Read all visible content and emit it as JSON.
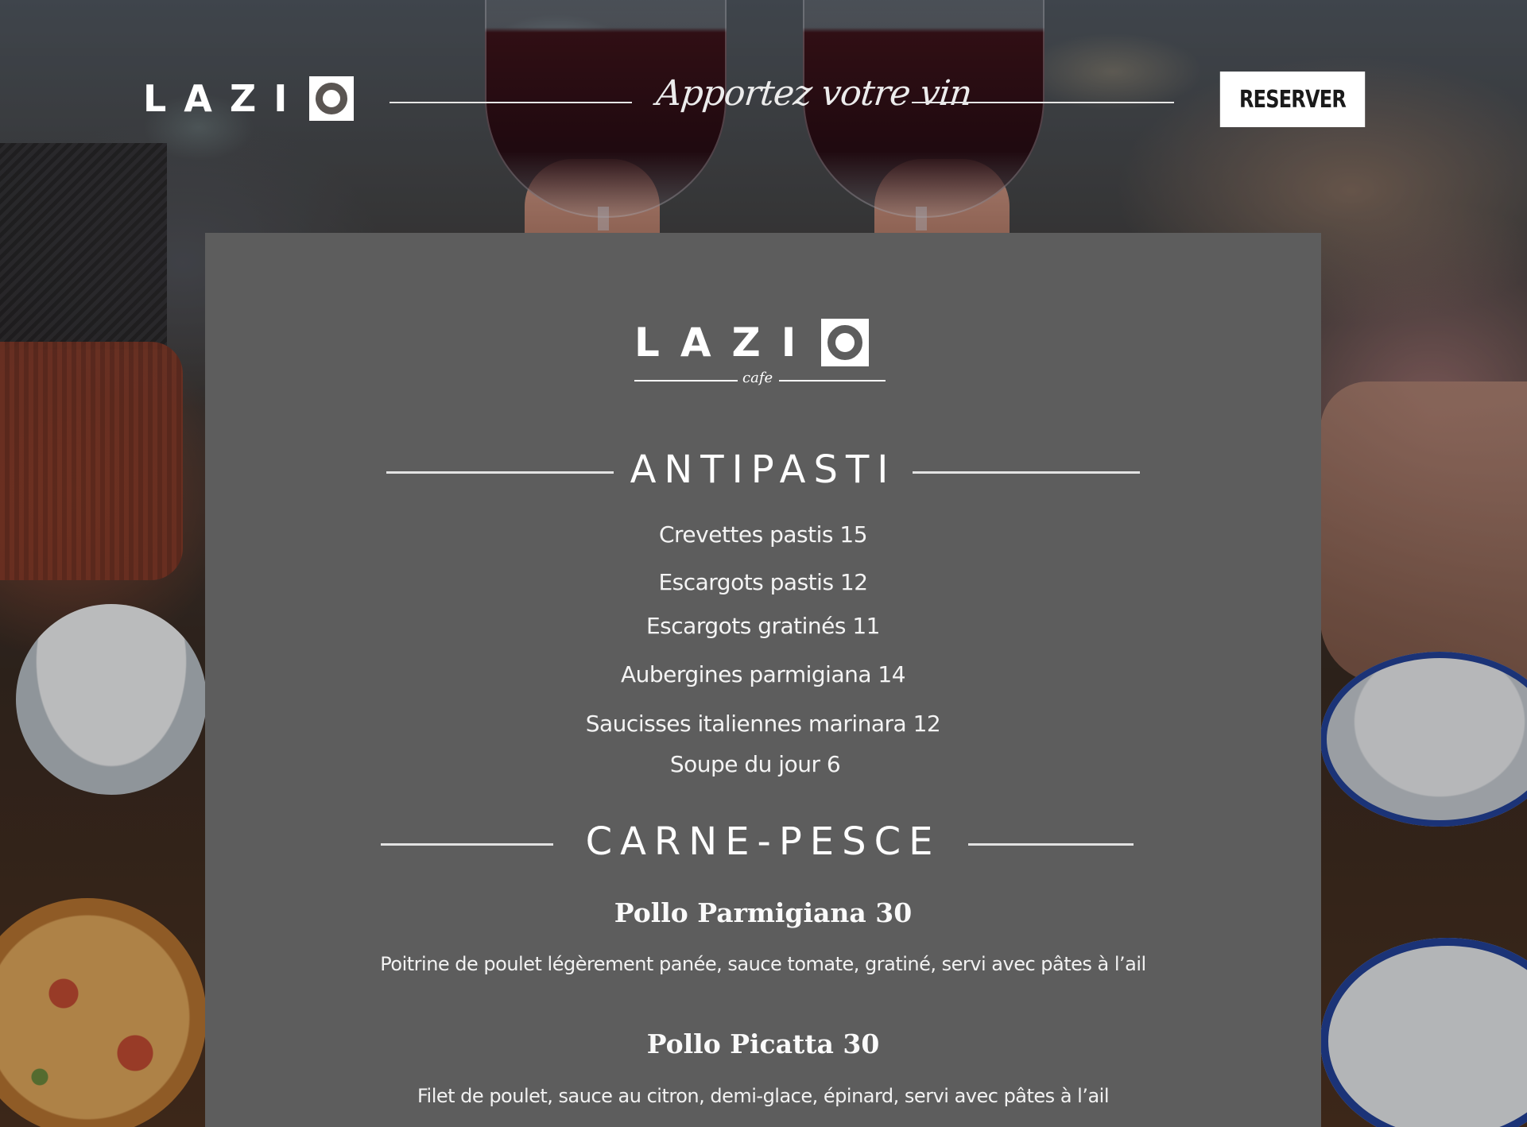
{
  "header": {
    "logo_text": "LAZI",
    "tagline": "Apportez votre vin",
    "reserve_label": "RESERVER"
  },
  "card": {
    "logo_text": "LAZI",
    "logo_subtext": "cafe",
    "sections": [
      {
        "title": "ANTIPASTI",
        "items": [
          "Crevettes pastis 15",
          "Escargots pastis 12",
          "Escargots gratinés 11",
          "Aubergines parmigiana 14",
          "Saucisses italiennes marinara 12",
          "Soupe du jour  6"
        ]
      },
      {
        "title": "CARNE-PESCE",
        "items": [
          {
            "name": "Pollo Parmigiana 30",
            "description": "Poitrine de poulet légèrement panée, sauce tomate, gratiné, servi avec pâtes à l’ail"
          },
          {
            "name": "Pollo Picatta 30",
            "description": "Filet de poulet, sauce au citron, demi-glace, épinard, servi avec pâtes à l’ail"
          }
        ]
      }
    ]
  },
  "colors": {
    "card_background": "#5d5d5d",
    "button_background": "#ffffff",
    "text": "#ffffff"
  }
}
